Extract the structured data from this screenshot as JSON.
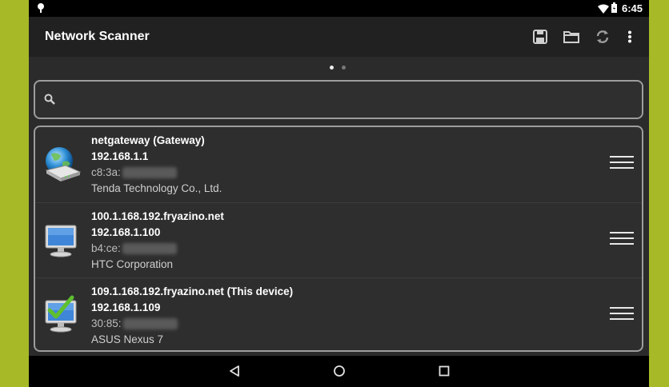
{
  "status": {
    "time": "6:45"
  },
  "actionbar": {
    "title": "Network Scanner",
    "icons": [
      "save-icon",
      "folder-icon",
      "refresh-icon",
      "overflow-menu-icon"
    ]
  },
  "pager": {
    "count": 2,
    "active": 0
  },
  "search": {
    "value": "",
    "placeholder": ""
  },
  "devices": [
    {
      "name": "netgateway (Gateway)",
      "ip": "192.168.1.1",
      "mac_prefix": "c8:3a:",
      "vendor": "Tenda Technology Co., Ltd.",
      "icon": "gateway-router-icon"
    },
    {
      "name": "100.1.168.192.fryazino.net",
      "ip": "192.168.1.100",
      "mac_prefix": "b4:ce:",
      "vendor": "HTC Corporation",
      "icon": "computer-monitor-icon"
    },
    {
      "name": "109.1.168.192.fryazino.net (This device)",
      "ip": "192.168.1.109",
      "mac_prefix": "30:85:",
      "vendor": "ASUS Nexus 7",
      "icon": "this-device-monitor-icon"
    }
  ],
  "colors": {
    "frame_background": "#a7b926",
    "action_bar": "#212121",
    "content_background": "#2b2b2b",
    "border": "#9d9d9d"
  }
}
